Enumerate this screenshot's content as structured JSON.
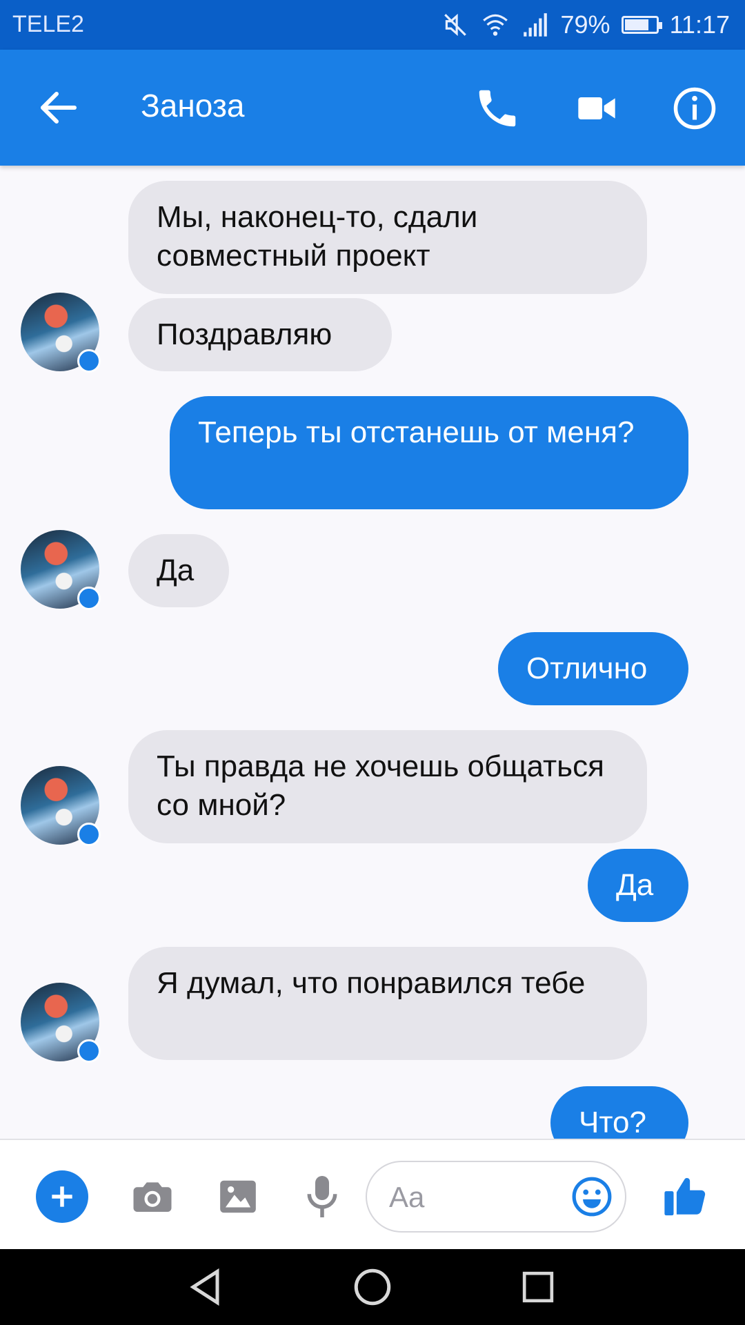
{
  "status_bar": {
    "carrier": "TELE2",
    "battery_percent": "79%",
    "battery_level": 0.79,
    "time": "11:17",
    "icons": [
      "mute-icon",
      "wifi-icon",
      "signal-icon",
      "battery-icon"
    ]
  },
  "header": {
    "title": "Заноза",
    "icons": [
      "back-arrow-icon",
      "phone-icon",
      "video-icon",
      "info-icon"
    ]
  },
  "messages": [
    {
      "dir": "in",
      "text": "Мы, наконец-то, сдали совместный проект"
    },
    {
      "dir": "in",
      "text": "Поздравляю"
    },
    {
      "dir": "out",
      "text": "Теперь ты отстанешь от меня?"
    },
    {
      "dir": "in",
      "text": "Да"
    },
    {
      "dir": "out",
      "text": "Отлично"
    },
    {
      "dir": "in",
      "text": "Ты правда не хочешь общаться со мной?"
    },
    {
      "dir": "out",
      "text": "Да"
    },
    {
      "dir": "in",
      "text": "Я думал, что понравился тебе"
    },
    {
      "dir": "out",
      "text": "Что?"
    }
  ],
  "composer": {
    "placeholder": "Aa",
    "icons": [
      "plus-icon",
      "camera-icon",
      "gallery-icon",
      "mic-icon",
      "emoji-icon",
      "like-icon"
    ]
  },
  "colors": {
    "status_bar": "#0a5fc8",
    "accent": "#1a7fe6",
    "incoming_bubble": "#e6e5eb",
    "background": "#f9f8fc"
  }
}
